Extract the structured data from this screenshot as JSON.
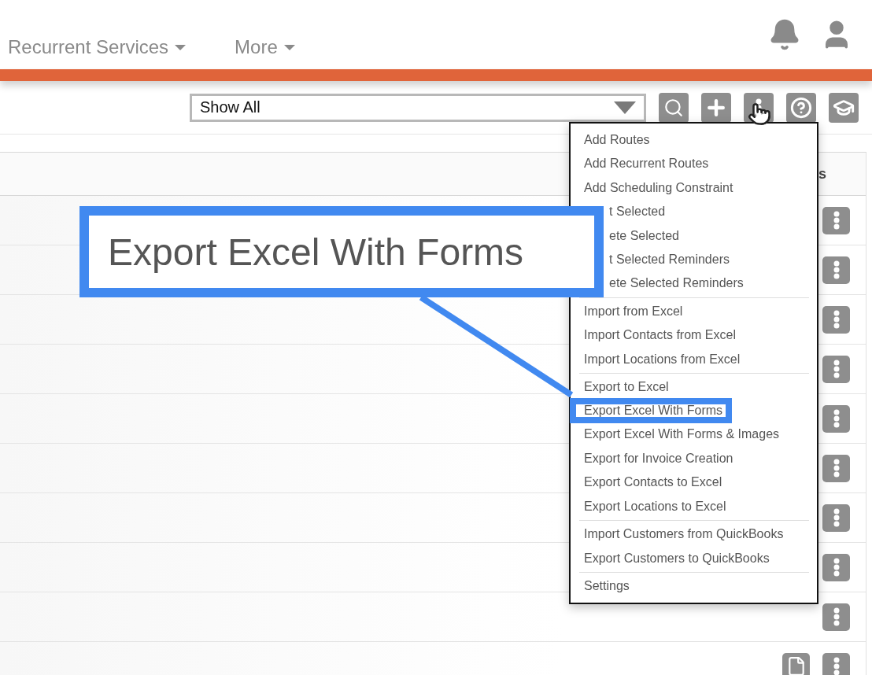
{
  "nav": [
    {
      "label": "Recurrent Services"
    },
    {
      "label": "More"
    }
  ],
  "filter": {
    "value": "Show All"
  },
  "table": {
    "columns": [
      {
        "label": "s"
      }
    ],
    "rows": [
      {
        "has_document": false
      },
      {
        "has_document": false
      },
      {
        "has_document": false
      },
      {
        "has_document": false
      },
      {
        "has_document": false
      },
      {
        "has_document": false
      },
      {
        "has_document": false
      },
      {
        "has_document": false
      },
      {
        "has_document": false
      },
      {
        "has_document": true
      }
    ]
  },
  "menu": {
    "groups": [
      {
        "items": [
          {
            "label": "Add Routes",
            "kind": "full",
            "highlighted": false
          },
          {
            "label": "Add Recurrent Routes",
            "kind": "full",
            "highlighted": false
          },
          {
            "label": "Add Scheduling Constraint",
            "kind": "full",
            "highlighted": false
          },
          {
            "label": "t Selected",
            "kind": "covered",
            "highlighted": false
          },
          {
            "label": "ete Selected",
            "kind": "covered",
            "highlighted": false
          },
          {
            "label": "t Selected Reminders",
            "kind": "covered",
            "highlighted": false
          },
          {
            "label": "ete Selected Reminders",
            "kind": "covered",
            "highlighted": false
          }
        ]
      },
      {
        "items": [
          {
            "label": "Import from Excel",
            "kind": "full",
            "highlighted": false
          },
          {
            "label": "Import Contacts from Excel",
            "kind": "full",
            "highlighted": false
          },
          {
            "label": "Import Locations from Excel",
            "kind": "full",
            "highlighted": false
          }
        ]
      },
      {
        "items": [
          {
            "label": "Export to Excel",
            "kind": "full",
            "highlighted": false
          },
          {
            "label": "Export Excel With Forms",
            "kind": "full",
            "highlighted": true
          },
          {
            "label": "Export Excel With Forms & Images",
            "kind": "full",
            "highlighted": false
          },
          {
            "label": "Export for Invoice Creation",
            "kind": "full",
            "highlighted": false
          },
          {
            "label": "Export Contacts to Excel",
            "kind": "full",
            "highlighted": false
          },
          {
            "label": "Export Locations to Excel",
            "kind": "full",
            "highlighted": false
          }
        ]
      },
      {
        "items": [
          {
            "label": "Import Customers from QuickBooks",
            "kind": "full",
            "highlighted": false
          },
          {
            "label": "Export Customers to QuickBooks",
            "kind": "full",
            "highlighted": false
          }
        ]
      },
      {
        "items": [
          {
            "label": "Settings",
            "kind": "full",
            "highlighted": false
          }
        ]
      }
    ]
  },
  "callout": {
    "text": "Export Excel With Forms"
  }
}
